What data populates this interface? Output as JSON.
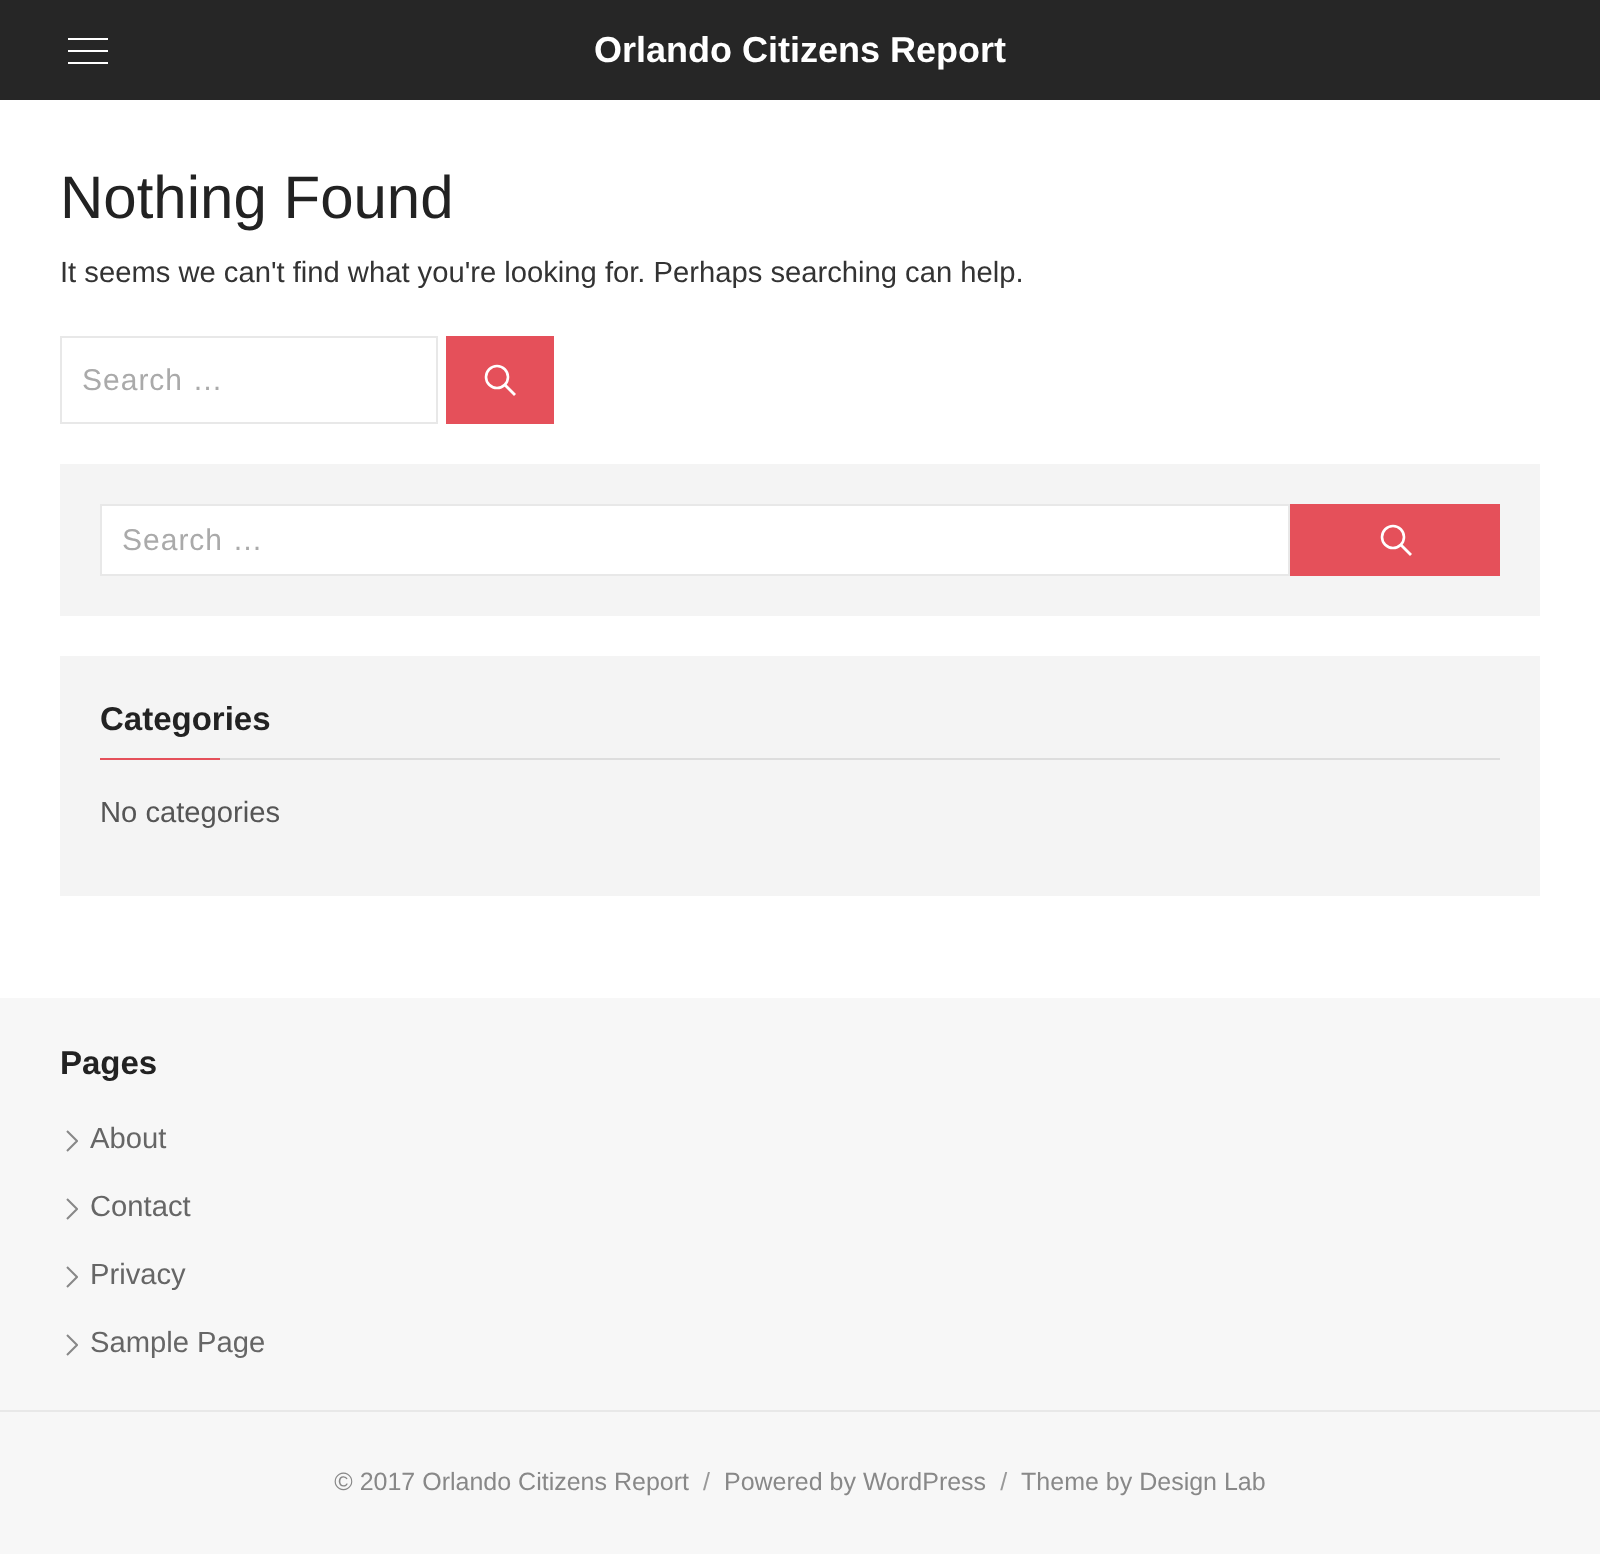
{
  "header": {
    "site_title": "Orlando Citizens Report"
  },
  "page": {
    "title": "Nothing Found",
    "message": "It seems we can't find what you're looking for. Perhaps searching can help.",
    "search": {
      "placeholder": "Search …"
    }
  },
  "sidebar": {
    "widgets": [
      {
        "kind": "search",
        "placeholder": "Search …"
      },
      {
        "kind": "list",
        "title": "Categories",
        "text": "No categories"
      }
    ]
  },
  "footer_widgets": {
    "title": "Pages",
    "items": [
      "About",
      "Contact",
      "Privacy",
      "Sample Page"
    ]
  },
  "footer": {
    "parts": [
      {
        "kind": "credit",
        "text": "© 2017 Orlando Citizens Report"
      },
      {
        "kind": "separator",
        "text": "/"
      },
      {
        "kind": "credit",
        "text": "Powered by WordPress"
      },
      {
        "kind": "separator",
        "text": "/"
      },
      {
        "kind": "credit",
        "text": "Theme by Design Lab"
      }
    ]
  }
}
